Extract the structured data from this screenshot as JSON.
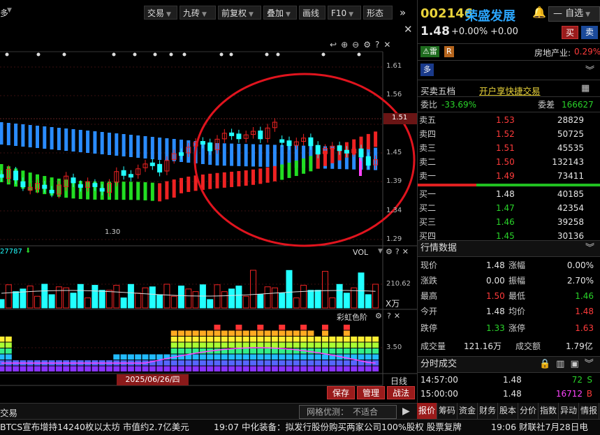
{
  "toolbar": {
    "left_label": "多",
    "buttons": [
      "交易",
      "九砖",
      "前复权",
      "叠加",
      "画线",
      "F10",
      "形态"
    ]
  },
  "chart": {
    "price_ticks": [
      "1.61",
      "1.56",
      "1.51",
      "1.45",
      "1.39",
      "1.34",
      "1.29"
    ],
    "current_price_tag": "1.51",
    "low_label": "1.30",
    "vol_left_label": "27787",
    "vol_title": "VOL",
    "vol_tick": "210.62",
    "vol_unit": "X万",
    "rainbow_title": "彩虹色阶",
    "rainbow_tick": "3.50",
    "date_label": "2025/06/26/四",
    "period_label": "日线",
    "buttons": [
      "保存",
      "管理",
      "战法"
    ]
  },
  "bottom_bar": {
    "left_label": "交易",
    "grid_label": "网格优测：",
    "grid_value": "不适合"
  },
  "stock": {
    "code": "002146",
    "name": "荣盛发展",
    "watch_label": "自选",
    "price": "1.48",
    "change_pct": "+0.00%",
    "change": "+0.00",
    "buy_btn": "买",
    "sell_btn": "卖",
    "tag_thunder": "雷",
    "tag_r": "R",
    "industry": "房地产业:",
    "industry_pct": "0.29%",
    "badge": "多"
  },
  "orderbook": {
    "title": "买卖五档",
    "link": "开户享快捷交易",
    "weibi_label": "委比",
    "weibi_value": "-33.69%",
    "weicha_label": "委差",
    "weicha_value": "166627",
    "asks": [
      {
        "label": "卖五",
        "price": "1.53",
        "vol": "28829"
      },
      {
        "label": "卖四",
        "price": "1.52",
        "vol": "50725"
      },
      {
        "label": "卖三",
        "price": "1.51",
        "vol": "45535"
      },
      {
        "label": "卖二",
        "price": "1.50",
        "vol": "132143"
      },
      {
        "label": "卖一",
        "price": "1.49",
        "vol": "73411"
      }
    ],
    "bids": [
      {
        "label": "买一",
        "price": "1.48",
        "vol": "40185"
      },
      {
        "label": "买二",
        "price": "1.47",
        "vol": "42354"
      },
      {
        "label": "买三",
        "price": "1.46",
        "vol": "39258"
      },
      {
        "label": "买四",
        "price": "1.45",
        "vol": "30136"
      }
    ]
  },
  "quote": {
    "title": "行情数据",
    "rows": [
      {
        "l1": "现价",
        "v1": "1.48",
        "c1": "white",
        "l2": "涨幅",
        "v2": "0.00%",
        "c2": "white"
      },
      {
        "l1": "涨跌",
        "v1": "0.00",
        "c1": "white",
        "l2": "振幅",
        "v2": "2.70%",
        "c2": "white"
      },
      {
        "l1": "最高",
        "v1": "1.50",
        "c1": "red",
        "l2": "最低",
        "v2": "1.46",
        "c2": "green"
      },
      {
        "l1": "今开",
        "v1": "1.48",
        "c1": "white",
        "l2": "均价",
        "v2": "1.48",
        "c2": "red"
      },
      {
        "l1": "跌停",
        "v1": "1.33",
        "c1": "green",
        "l2": "涨停",
        "v2": "1.63",
        "c2": "red"
      }
    ],
    "vol_label": "成交量",
    "vol_value": "121.16万",
    "amt_label": "成交额",
    "amt_value": "1.79亿"
  },
  "ticks": {
    "title": "分时成交",
    "rows": [
      {
        "time": "14:57:00",
        "price": "1.48",
        "vol": "72",
        "dir": "S"
      },
      {
        "time": "15:00:00",
        "price": "1.48",
        "vol": "16712",
        "dir": "B"
      }
    ]
  },
  "tabs": [
    "报价",
    "筹码",
    "资金",
    "财务",
    "股本",
    "分价",
    "指数",
    "异动",
    "情报"
  ],
  "ticker": {
    "items": [
      "BTCS宣布增持14240枚以太坊 市值约2.7亿美元",
      "19:07 中化装备：拟发行股份购买两家公司100%股权 股票复牌",
      "19:06 财联社7月28日电"
    ]
  }
}
